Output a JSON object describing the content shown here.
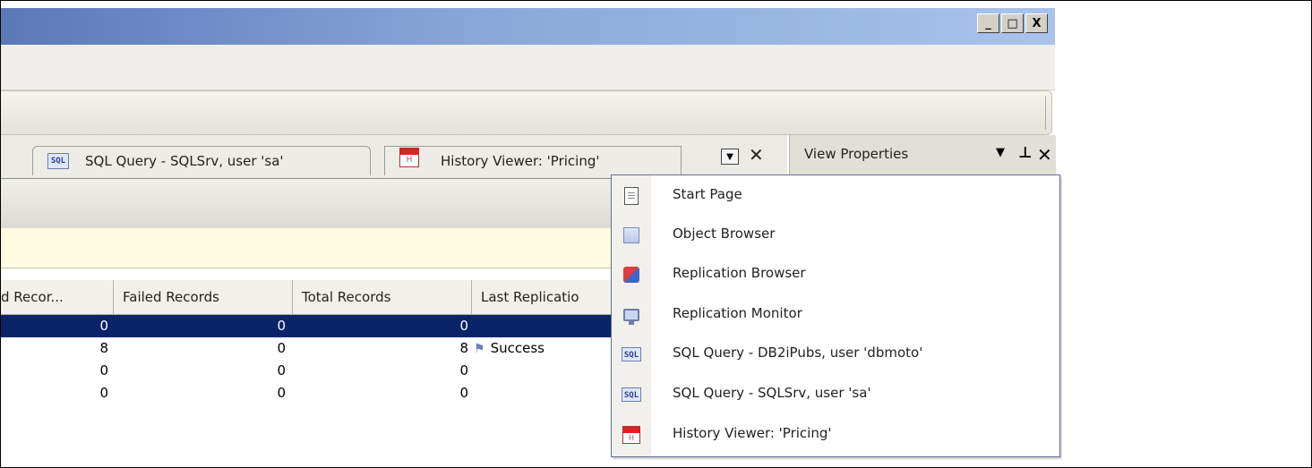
{
  "window": {
    "controls": {
      "minimize": "_",
      "maximize": "□",
      "close": "X"
    }
  },
  "tabs": [
    {
      "label": "SQL Query - SQLSrv, user 'sa'",
      "icon": "sql-icon",
      "icon_text": "SQL"
    },
    {
      "label": "History Viewer: 'Pricing'",
      "icon": "calendar-icon",
      "icon_text": "H"
    }
  ],
  "tab_controls": {
    "dropdown": "▼",
    "close": "✕"
  },
  "view_properties": {
    "title": "View Properties",
    "dropdown": "▼",
    "pin": "⊥",
    "close": "✕"
  },
  "grid": {
    "columns": [
      "d Recor...",
      "Failed Records",
      "Total Records",
      "Last  Replicatio"
    ],
    "rows": [
      {
        "c1": "0",
        "c2": "0",
        "c3": "0",
        "c4": "",
        "selected": true
      },
      {
        "c1": "8",
        "c2": "0",
        "c3": "8",
        "c4": "Success",
        "flag": true
      },
      {
        "c1": "0",
        "c2": "0",
        "c3": "0",
        "c4": ""
      },
      {
        "c1": "0",
        "c2": "0",
        "c3": "0",
        "c4": ""
      }
    ]
  },
  "menu": {
    "items": [
      {
        "label": "Start Page",
        "icon": "page-icon"
      },
      {
        "label": "Object Browser",
        "icon": "object-browser-icon"
      },
      {
        "label": "Replication Browser",
        "icon": "replication-icon"
      },
      {
        "label": "Replication Monitor",
        "icon": "monitor-icon"
      },
      {
        "label": "SQL Query - DB2iPubs, user 'dbmoto'",
        "icon": "sql-icon",
        "icon_text": "SQL"
      },
      {
        "label": "SQL Query - SQLSrv, user 'sa'",
        "icon": "sql-icon",
        "icon_text": "SQL"
      },
      {
        "label": "History Viewer: 'Pricing'",
        "icon": "calendar-icon",
        "icon_text": "H"
      }
    ]
  },
  "colors": {
    "selection": "#0a246a",
    "titlebar_start": "#5b79b8",
    "titlebar_end": "#a9c3ec",
    "info_band": "#fffbe0",
    "success_flag": "#6d7fbb"
  }
}
